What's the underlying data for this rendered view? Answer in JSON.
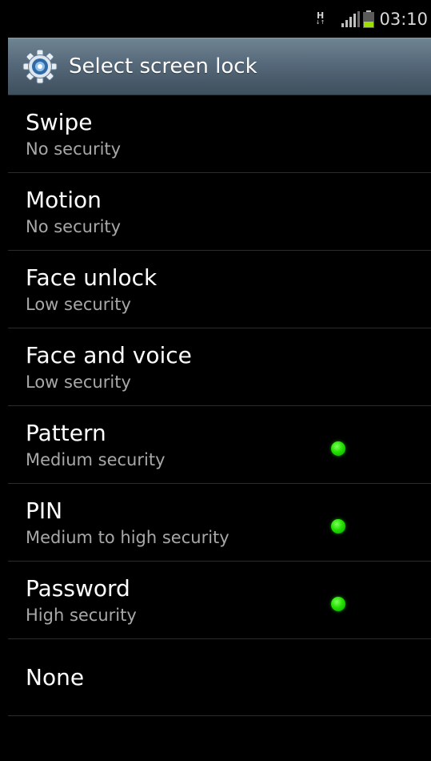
{
  "status_bar": {
    "network_type": "H",
    "network_arrows": "↓↑",
    "signal_icon": "signal-bars-icon",
    "battery_icon": "battery-icon",
    "battery_color": "#9be000",
    "time": "03:10"
  },
  "header": {
    "icon": "settings-gear-icon",
    "title": "Select screen lock"
  },
  "options": [
    {
      "title": "Swipe",
      "subtitle": "No security",
      "available": false
    },
    {
      "title": "Motion",
      "subtitle": "No security",
      "available": false
    },
    {
      "title": "Face unlock",
      "subtitle": "Low security",
      "available": false
    },
    {
      "title": "Face and voice",
      "subtitle": "Low security",
      "available": false
    },
    {
      "title": "Pattern",
      "subtitle": "Medium security",
      "available": true
    },
    {
      "title": "PIN",
      "subtitle": "Medium to high security",
      "available": true
    },
    {
      "title": "Password",
      "subtitle": "High security",
      "available": true
    },
    {
      "title": "None"
    }
  ],
  "colors": {
    "background": "#000000",
    "title_bar": "#56697a",
    "status_dot": "#22e000",
    "subtitle_text": "#a8a8a8"
  }
}
